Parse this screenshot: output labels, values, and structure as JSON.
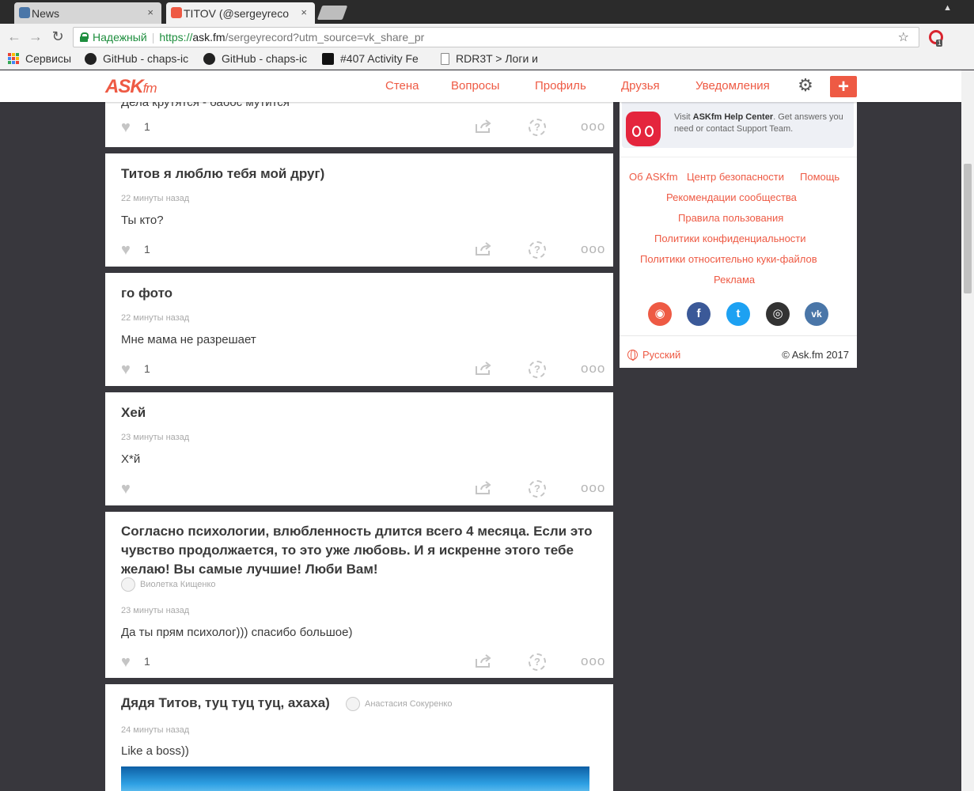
{
  "browser": {
    "tabs": [
      {
        "label": "News",
        "favicon_color": "#4a76a8"
      },
      {
        "label": "TITOV (@sergeyreco",
        "favicon_color": "#ee5a44"
      }
    ],
    "tab_close": "×",
    "back_icon": "←",
    "forward_icon": "→",
    "reload_icon": "↻",
    "secure_label": "Надежный",
    "url_proto": "https://",
    "url_host": "ask.fm",
    "url_rest": "/sergeyrecord?utm_source=vk_share_pr",
    "star_icon": "☆",
    "ext_badge": "1",
    "menu_icon": "⋮",
    "bookmarks": [
      {
        "label": "Сервисы"
      },
      {
        "label": "GitHub - chaps-ic"
      },
      {
        "label": "GitHub - chaps-ic"
      },
      {
        "label": "#407 Activity Fe"
      },
      {
        "label": "RDR3T > Логи и "
      }
    ]
  },
  "site": {
    "logo_main": "ASK",
    "logo_suffix": "fm",
    "nav": [
      "Стена",
      "Вопросы",
      "Профиль",
      "Друзья",
      "Уведомления"
    ],
    "settings_icon": "⚙",
    "plus_label": "+",
    "accent": "#ee5a44"
  },
  "feed": {
    "like_icon": "♥",
    "share_icon": "share-icon",
    "ask_icon": "?",
    "more_icon": "ooo",
    "cards": [
      {
        "question": "Дела крутятся - бабос мутится",
        "time": "",
        "answer": "",
        "likes": "1"
      },
      {
        "question": "Титов я люблю тебя мой друг)",
        "time": "22 минуты назад",
        "answer": "Ты кто?",
        "likes": "1"
      },
      {
        "question": "го фото",
        "time": "22 минуты назад",
        "answer": "Мне мама не разрешает",
        "likes": "1"
      },
      {
        "question": "Хей",
        "time": "23 минуты назад",
        "answer": "Х*й",
        "likes": ""
      },
      {
        "question": "Согласно психологии, влюбленность длится всего 4 месяца. Если это чувство продолжается, то это уже любовь. И я искренне этого тебе желаю! Вы самые лучшие! Люби Вам!",
        "asker": "Виолетка Кищенко",
        "time": "23 минуты назад",
        "answer": "Да ты прям психолог))) спасибо большое)",
        "likes": "1"
      },
      {
        "question": "Дядя Титов, туц туц туц, ахаха)",
        "asker": "Анастасия Сокуренко",
        "time": "24 минуты назад",
        "answer": "Like a boss))",
        "likes": ""
      }
    ]
  },
  "sidebar": {
    "help_prefix": "Visit ",
    "help_bold": "ASKfm Help Center",
    "help_suffix": ". Get answers you need or contact Support Team.",
    "links": [
      "Об ASKfm",
      "Центр безопасности",
      "Помощь",
      "Рекомендации сообщества",
      "Правила пользования",
      "Политики конфиденциальности",
      "Политики относительно куки-файлов",
      "Реклама"
    ],
    "socials": [
      {
        "name": "askfm",
        "glyph": "◉",
        "color": "#ee5a44"
      },
      {
        "name": "facebook",
        "glyph": "f",
        "color": "#3b5998"
      },
      {
        "name": "twitter",
        "glyph": "t",
        "color": "#1da1f2"
      },
      {
        "name": "instagram",
        "glyph": "◎",
        "color": "#333333"
      },
      {
        "name": "vk",
        "glyph": "vk",
        "color": "#4a76a8"
      }
    ],
    "language": "Русский",
    "copyright": "© Ask.fm 2017"
  }
}
